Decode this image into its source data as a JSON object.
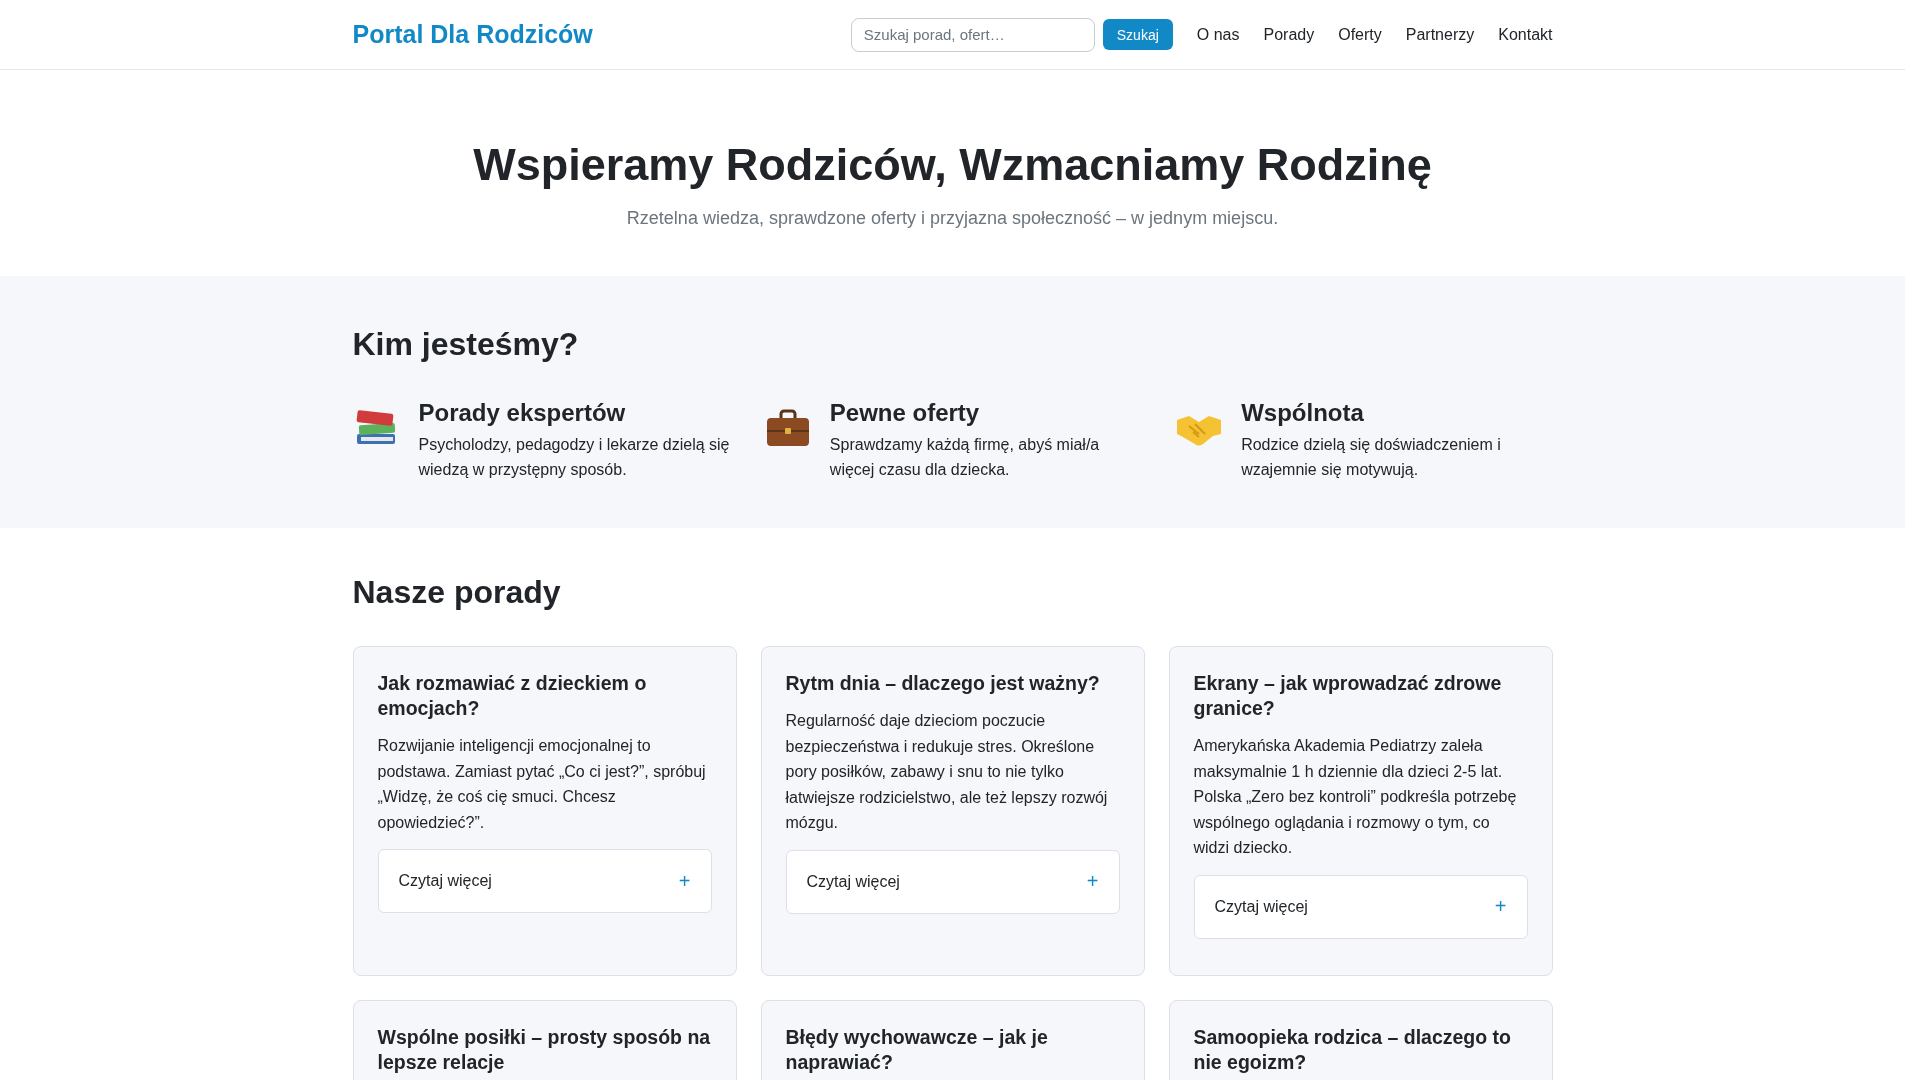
{
  "header": {
    "brand": "Portal Dla Rodziców",
    "search": {
      "placeholder": "Szukaj porad, ofert…"
    },
    "search_button": "Szukaj",
    "nav": [
      {
        "label": "O nas"
      },
      {
        "label": "Porady"
      },
      {
        "label": "Oferty"
      },
      {
        "label": "Partnerzy"
      },
      {
        "label": "Kontakt"
      }
    ]
  },
  "hero": {
    "title": "Wspieramy Rodziców, Wzmacniamy Rodzinę",
    "subtitle": "Rzetelna wiedza, sprawdzone oferty i przyjazna społeczność – w jednym miejscu."
  },
  "about": {
    "heading": "Kim jesteśmy?",
    "features": [
      {
        "kind": "books",
        "title": "Porady ekspertów",
        "text": "Psycholodzy, pedagodzy i lekarze dzielą się wiedzą w przystępny sposób."
      },
      {
        "kind": "briefcase",
        "title": "Pewne oferty",
        "text": "Sprawdzamy każdą firmę, abyś miał/a więcej czasu dla dziecka."
      },
      {
        "kind": "handshake",
        "title": "Wspólnota",
        "text": "Rodzice dzielą się doświadczeniem i wzajemnie się motywują."
      }
    ]
  },
  "advice": {
    "heading": "Nasze porady",
    "cards": [
      {
        "title": "Jak rozmawiać z dzieckiem o emocjach?",
        "text": "Rozwijanie inteligencji emocjonalnej to podstawa. Zamiast pytać „Co ci jest?”, spróbuj „Widzę, że coś cię smuci. Chcesz opowiedzieć?”.",
        "more": {
          "label": "Czytaj więcej",
          "symbol": "+",
          "expanded": false
        }
      },
      {
        "title": "Rytm dnia – dlaczego jest ważny?",
        "text": "Regularność daje dzieciom poczucie bezpieczeństwa i redukuje stres. Określone pory posiłków, zabawy i snu to nie tylko łatwiejsze rodzicielstwo, ale też lepszy rozwój mózgu.",
        "more": {
          "label": "Czytaj więcej",
          "symbol": "+",
          "expanded": false
        }
      },
      {
        "title": "Ekrany – jak wprowadzać zdrowe granice?",
        "text": "Amerykańska Akademia Pediatrzy zaleła maksymalnie 1 h dziennie dla dzieci 2-5 lat. Polska „Zero bez kontroli” podkreśla potrzebę wspólnego oglądania i rozmowy o tym, co widzi dziecko.",
        "more": {
          "label": "Czytaj więcej",
          "symbol": "+",
          "expanded": false
        }
      },
      {
        "title": "Wspólne posiłki – prosty sposób na lepsze relacje"
      },
      {
        "title": "Błędy wychowawcze – jak je naprawiać?"
      },
      {
        "title": "Samoopieka rodzica – dlaczego to nie egoizm?"
      }
    ]
  }
}
